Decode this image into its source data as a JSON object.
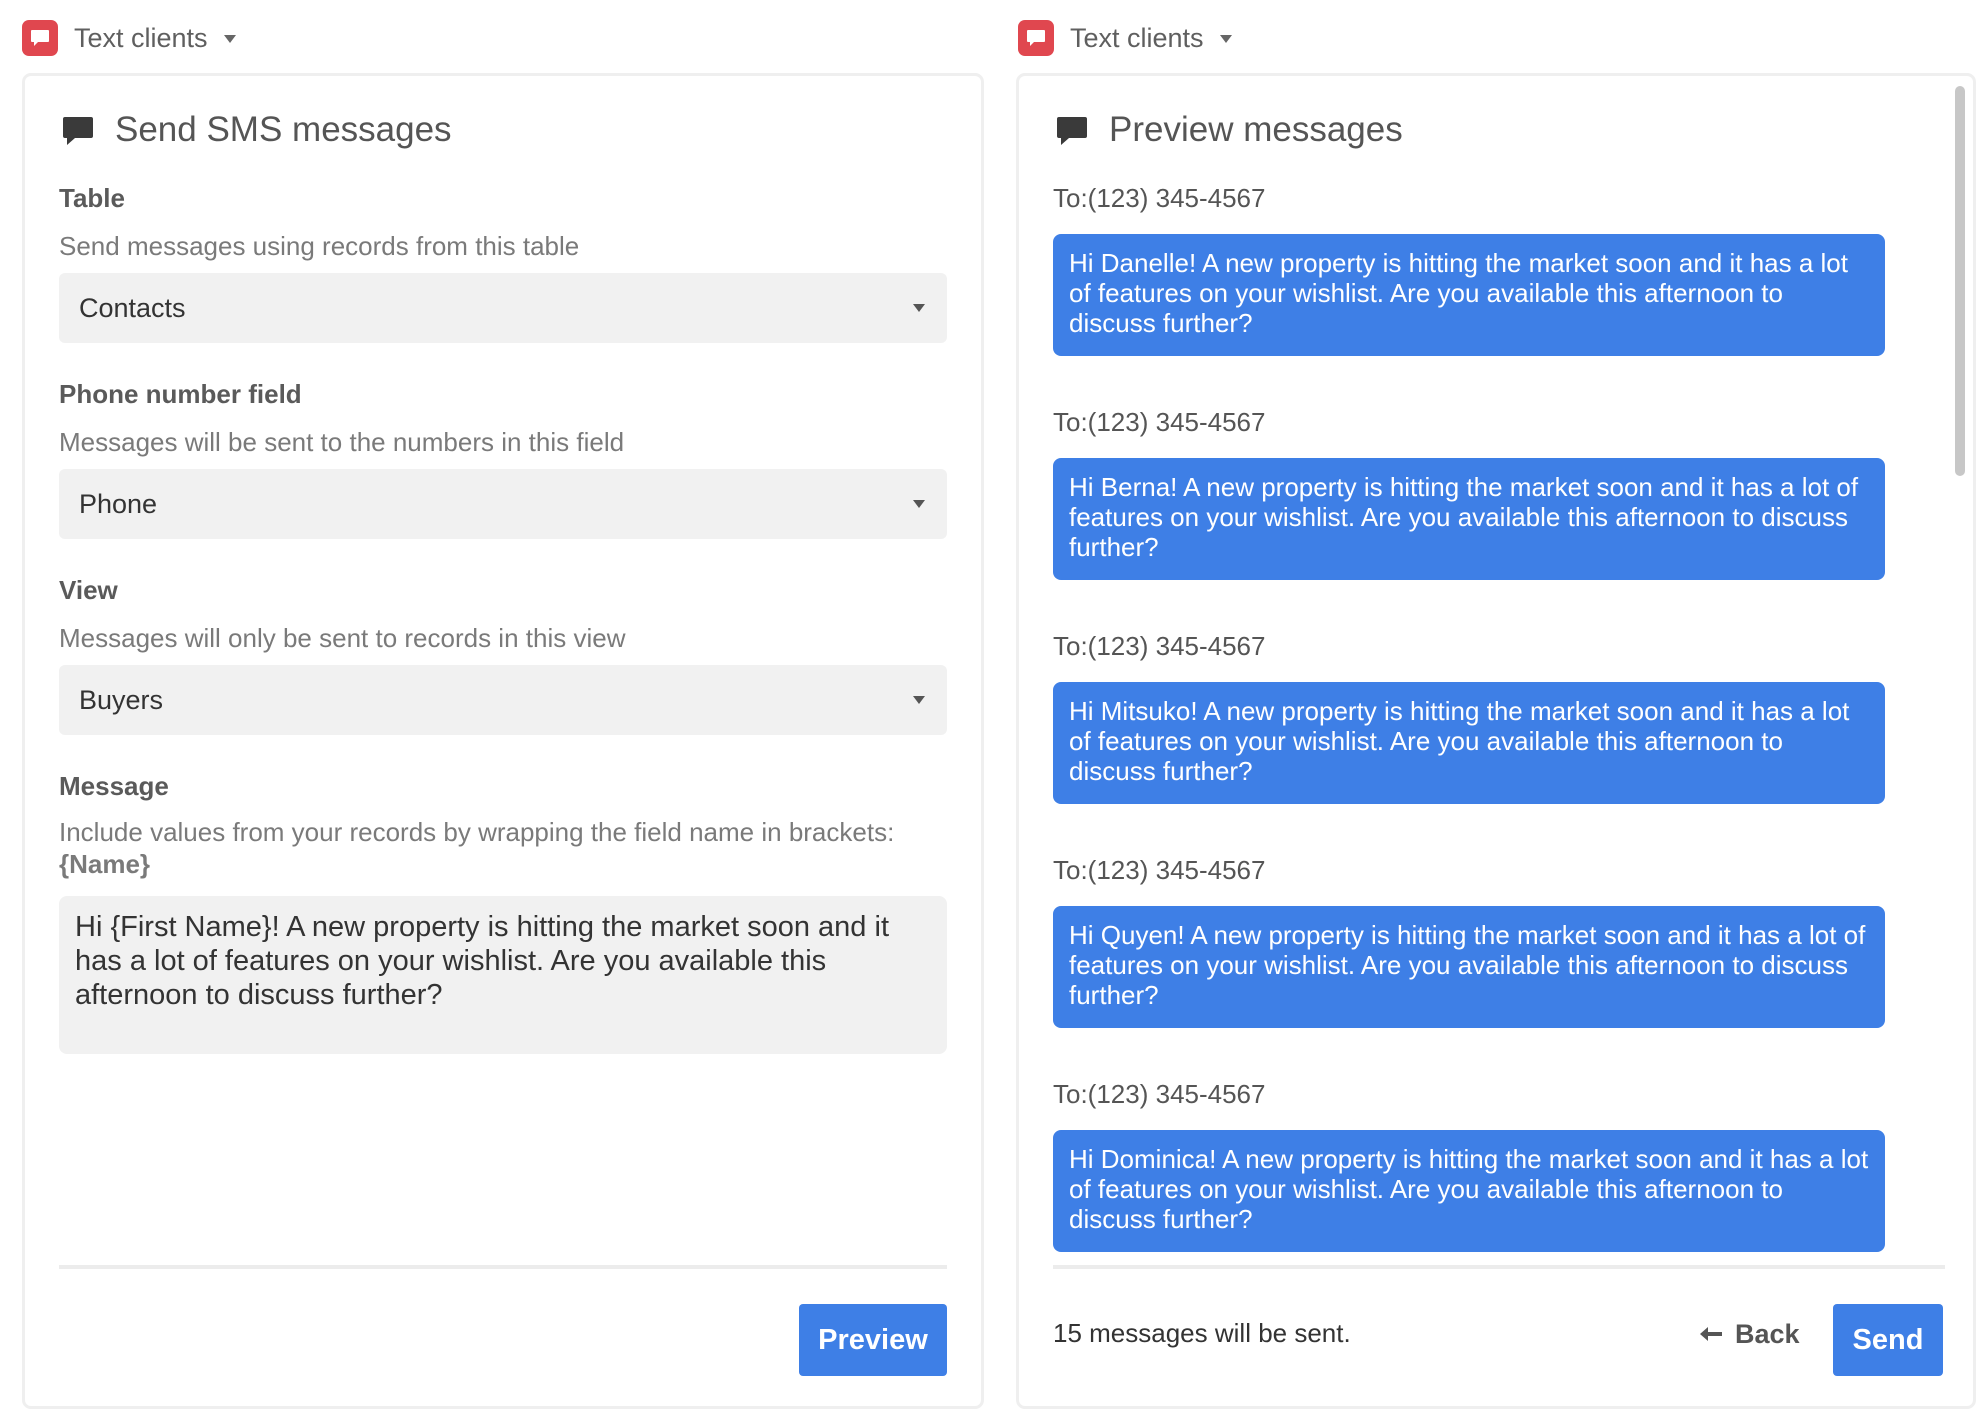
{
  "colors": {
    "brand_red": "#e0474f",
    "accent_blue": "#3e7fe6"
  },
  "app": {
    "name": "Text clients"
  },
  "send_panel": {
    "title": "Send SMS messages",
    "table_field": {
      "label": "Table",
      "description": "Send messages using records from this table",
      "value": "Contacts"
    },
    "phone_field": {
      "label": "Phone number field",
      "description": "Messages will be sent to the numbers in this field",
      "value": "Phone"
    },
    "view_field": {
      "label": "View",
      "description": "Messages will only be sent to records in this view",
      "value": "Buyers"
    },
    "message_field": {
      "label": "Message",
      "description": "Include values from your records by wrapping the field name in brackets:",
      "description_example": "{Name}",
      "value": "Hi {First Name}! A new property is hitting the market soon and it has a lot of features on your wishlist. Are you available this afternoon to discuss further?"
    },
    "preview_button": "Preview"
  },
  "preview_panel": {
    "title": "Preview messages",
    "messages": [
      {
        "to": "To:(123) 345-4567",
        "text": "Hi Danelle! A new property is hitting the market soon and it has a lot of features on your wishlist. Are you available this afternoon to discuss further?"
      },
      {
        "to": "To:(123) 345-4567",
        "text": "Hi Berna! A new property is hitting the market soon and it has a lot of features on your wishlist. Are you available this afternoon to discuss further?"
      },
      {
        "to": "To:(123) 345-4567",
        "text": "Hi Mitsuko! A new property is hitting the market soon and it has a lot of features on your wishlist. Are you available this afternoon to discuss further?"
      },
      {
        "to": "To:(123) 345-4567",
        "text": "Hi Quyen! A new property is hitting the market soon and it has a lot of features on your wishlist. Are you available this afternoon to discuss further?"
      },
      {
        "to": "To:(123) 345-4567",
        "text": "Hi Dominica! A new property is hitting the market soon and it has a lot of features on your wishlist. Are you available this afternoon to discuss further?"
      }
    ],
    "summary": "15 messages will be sent.",
    "back_button": "Back",
    "send_button": "Send"
  }
}
